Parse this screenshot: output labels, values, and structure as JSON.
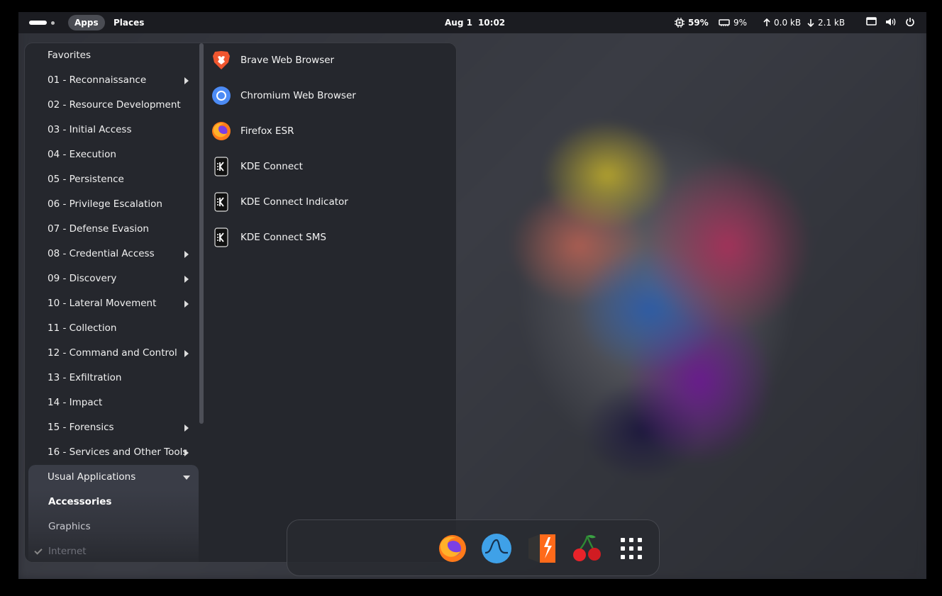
{
  "topbar": {
    "apps_label": "Apps",
    "places_label": "Places",
    "date": "Aug 1",
    "time": "10:02",
    "cpu": "59%",
    "memory": "9%",
    "net_up": "0.0 kB",
    "net_down": "2.1 kB"
  },
  "menu": {
    "categories": [
      {
        "label": "Favorites",
        "has_submenu": false
      },
      {
        "label": "01 - Reconnaissance",
        "has_submenu": true
      },
      {
        "label": "02 - Resource Development",
        "has_submenu": false
      },
      {
        "label": "03 - Initial Access",
        "has_submenu": false
      },
      {
        "label": "04 - Execution",
        "has_submenu": false
      },
      {
        "label": "05 - Persistence",
        "has_submenu": false
      },
      {
        "label": "06 - Privilege Escalation",
        "has_submenu": false
      },
      {
        "label": "07 - Defense Evasion",
        "has_submenu": false
      },
      {
        "label": "08 - Credential Access",
        "has_submenu": true
      },
      {
        "label": "09 - Discovery",
        "has_submenu": true
      },
      {
        "label": "10 - Lateral Movement",
        "has_submenu": true
      },
      {
        "label": "11 - Collection",
        "has_submenu": false
      },
      {
        "label": "12 - Command and Control",
        "has_submenu": true
      },
      {
        "label": "13 - Exfiltration",
        "has_submenu": false
      },
      {
        "label": "14 - Impact",
        "has_submenu": false
      },
      {
        "label": "15 - Forensics",
        "has_submenu": true
      },
      {
        "label": "16 - Services and Other Tools",
        "has_submenu": true
      },
      {
        "label": "Usual Applications",
        "expanded": true
      }
    ],
    "subcategories": [
      "Accessories",
      "Graphics",
      "Internet"
    ],
    "apps": [
      {
        "label": "Brave Web Browser",
        "icon": "brave-icon"
      },
      {
        "label": "Chromium Web Browser",
        "icon": "chromium-icon"
      },
      {
        "label": "Firefox ESR",
        "icon": "firefox-icon"
      },
      {
        "label": "KDE Connect",
        "icon": "kde-connect-icon"
      },
      {
        "label": "KDE Connect Indicator",
        "icon": "kde-connect-icon"
      },
      {
        "label": "KDE Connect SMS",
        "icon": "kde-connect-icon"
      }
    ]
  },
  "dock": {
    "items": [
      "firefox-icon",
      "wireshark-icon",
      "burpsuite-icon",
      "cherrytree-icon",
      "app-grid-icon"
    ]
  },
  "colors": {
    "panel": "#25272d",
    "topbar": "#1b1c21",
    "highlight": "#3a3d47"
  }
}
